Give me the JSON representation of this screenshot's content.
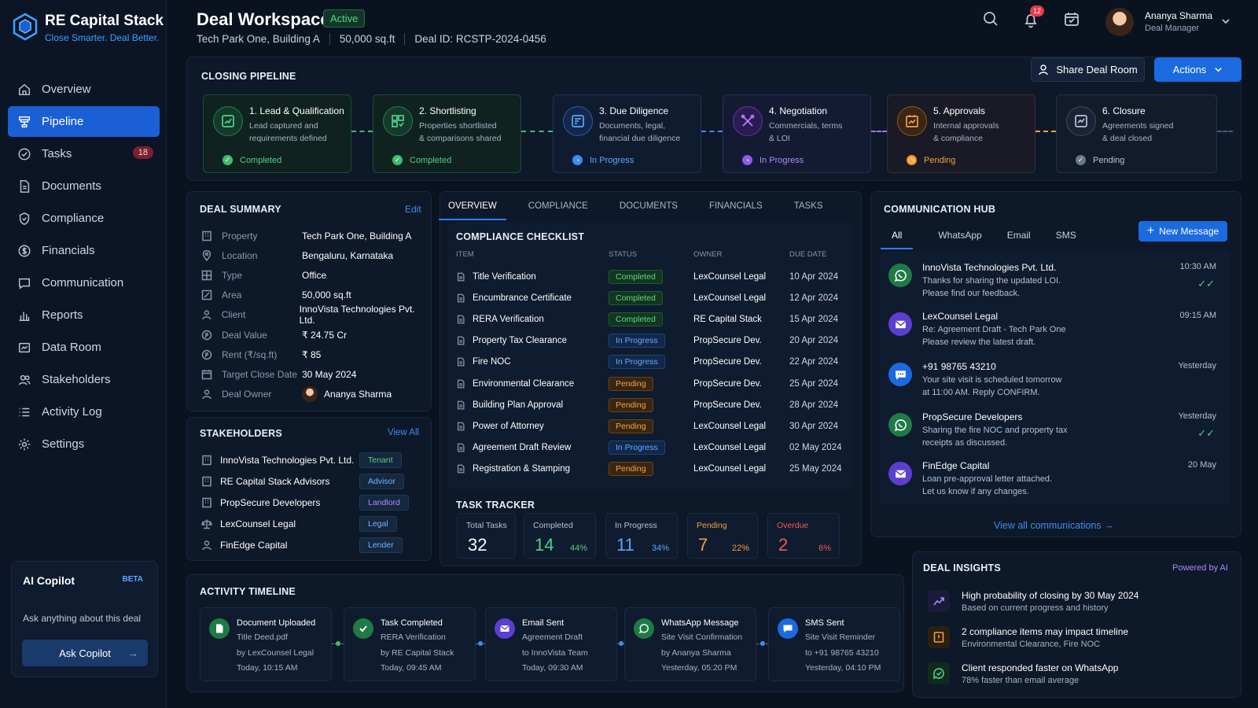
{
  "brand": {
    "name": "RE Capital Stack",
    "tagline": "Close Smarter. Deal Better."
  },
  "nav": [
    {
      "label": "Overview",
      "icon": "home-icon"
    },
    {
      "label": "Pipeline",
      "icon": "pipeline-icon",
      "active": true
    },
    {
      "label": "Tasks",
      "icon": "check-circle-icon",
      "badge": "18"
    },
    {
      "label": "Documents",
      "icon": "document-icon"
    },
    {
      "label": "Compliance",
      "icon": "shield-icon"
    },
    {
      "label": "Financials",
      "icon": "dollar-icon"
    },
    {
      "label": "Communication",
      "icon": "chat-icon"
    },
    {
      "label": "Reports",
      "icon": "bar-chart-icon"
    },
    {
      "label": "Data Room",
      "icon": "folder-icon"
    },
    {
      "label": "Stakeholders",
      "icon": "users-icon"
    },
    {
      "label": "Activity Log",
      "icon": "list-icon"
    },
    {
      "label": "Settings",
      "icon": "gear-icon"
    }
  ],
  "copilot": {
    "title": "AI  Copilot",
    "beta": "BETA",
    "prompt": "Ask anything about this deal",
    "button": "Ask Copilot"
  },
  "header": {
    "title": "Deal Workspace",
    "status": "Active",
    "property": "Tech Park One, Building A",
    "area": "50,000 sq.ft",
    "deal_id": "Deal ID: RCSTP-2024-0456",
    "notifications": "12",
    "user_name": "Ananya Sharma",
    "user_role": "Deal Manager",
    "share_label": "Share Deal Room",
    "actions_label": "Actions"
  },
  "pipeline": {
    "title": "CLOSING PIPELINE",
    "stages": [
      {
        "title": "1. Lead & Qualification",
        "desc1": "Lead captured and",
        "desc2": "requirements defined",
        "status": "Completed",
        "color": "#3dbd6e"
      },
      {
        "title": "2. Shortlisting",
        "desc1": "Properties shortlisted",
        "desc2": "& comparisons shared",
        "status": "Completed",
        "color": "#3dbd6e"
      },
      {
        "title": "3. Due Diligence",
        "desc1": "Documents, legal,",
        "desc2": "financial due diligence",
        "status": "In Progress",
        "color": "#3b8cf5"
      },
      {
        "title": "4. Negotiation",
        "desc1": "Commercials, terms",
        "desc2": "& LOI",
        "status": "In Progress",
        "color": "#8a5cf0"
      },
      {
        "title": "5. Approvals",
        "desc1": "Internal approvals",
        "desc2": "& compliance",
        "status": "Pending",
        "color": "#f0962e"
      },
      {
        "title": "6. Closure",
        "desc1": "Agreements signed",
        "desc2": "& deal closed",
        "status": "Pending",
        "color": "#9aa6b8"
      }
    ]
  },
  "deal_summary": {
    "title": "DEAL SUMMARY",
    "edit": "Edit",
    "rows": [
      {
        "label": "Property",
        "value": "Tech Park One, Building A"
      },
      {
        "label": "Location",
        "value": "Bengaluru, Karnataka"
      },
      {
        "label": "Type",
        "value": "Office"
      },
      {
        "label": "Area",
        "value": "50,000 sq.ft"
      },
      {
        "label": "Client",
        "value": "InnoVista Technologies Pvt. Ltd."
      },
      {
        "label": "Deal Value",
        "value": "₹ 24.75 Cr"
      },
      {
        "label": "Rent (₹/sq.ft)",
        "value": "₹ 85"
      },
      {
        "label": "Target Close Date",
        "value": "30 May 2024"
      },
      {
        "label": "Deal Owner",
        "value": "Ananya Sharma"
      }
    ]
  },
  "stakeholders": {
    "title": "STAKEHOLDERS",
    "view_all": "View All",
    "items": [
      {
        "name": "InnoVista Technologies Pvt. Ltd.",
        "role": "Tenant",
        "color": "#4fd08a"
      },
      {
        "name": "RE Capital Stack Advisors",
        "role": "Advisor",
        "color": "#6fb2ff"
      },
      {
        "name": "PropSecure Developers",
        "role": "Landlord",
        "color": "#a98bff"
      },
      {
        "name": "LexCounsel Legal",
        "role": "Legal",
        "color": "#6fb2ff"
      },
      {
        "name": "FinEdge Capital",
        "role": "Lender",
        "color": "#6fb2ff"
      }
    ]
  },
  "tabs": [
    "OVERVIEW",
    "COMPLIANCE",
    "DOCUMENTS",
    "FINANCIALS",
    "TASKS"
  ],
  "checklist": {
    "title": "COMPLIANCE CHECKLIST",
    "headers": [
      "ITEM",
      "STATUS",
      "OWNER",
      "DUE DATE"
    ],
    "rows": [
      {
        "item": "Title Verification",
        "status": "Completed",
        "owner": "LexCounsel Legal",
        "due": "10 Apr 2024"
      },
      {
        "item": "Encumbrance Certificate",
        "status": "Completed",
        "owner": "LexCounsel Legal",
        "due": "12 Apr 2024"
      },
      {
        "item": "RERA Verification",
        "status": "Completed",
        "owner": "RE Capital Stack",
        "due": "15 Apr 2024"
      },
      {
        "item": "Property Tax Clearance",
        "status": "In Progress",
        "owner": "PropSecure Dev.",
        "due": "20 Apr 2024"
      },
      {
        "item": "Fire NOC",
        "status": "In Progress",
        "owner": "PropSecure Dev.",
        "due": "22 Apr 2024"
      },
      {
        "item": "Environmental Clearance",
        "status": "Pending",
        "owner": "PropSecure Dev.",
        "due": "25 Apr 2024"
      },
      {
        "item": "Building Plan Approval",
        "status": "Pending",
        "owner": "PropSecure Dev.",
        "due": "28 Apr 2024"
      },
      {
        "item": "Power of Attorney",
        "status": "Pending",
        "owner": "LexCounsel Legal",
        "due": "30 Apr 2024"
      },
      {
        "item": "Agreement Draft Review",
        "status": "In Progress",
        "owner": "LexCounsel Legal",
        "due": "02 May 2024"
      },
      {
        "item": "Registration & Stamping",
        "status": "Pending",
        "owner": "LexCounsel Legal",
        "due": "25 May 2024"
      }
    ]
  },
  "task_tracker": {
    "title": "TASK TRACKER",
    "stats": [
      {
        "label": "Total Tasks",
        "value": "32",
        "pct": "",
        "color": "#b8c3d3",
        "valcolor": "#ffffff"
      },
      {
        "label": "Completed",
        "value": "14",
        "pct": "44%",
        "color": "#b8c3d3",
        "valcolor": "#4fd08a"
      },
      {
        "label": "In Progress",
        "value": "11",
        "pct": "34%",
        "color": "#b8c3d3",
        "valcolor": "#5aa8ff"
      },
      {
        "label": "Pending",
        "value": "7",
        "pct": "22%",
        "color": "#f0a040",
        "valcolor": "#f0a040"
      },
      {
        "label": "Overdue",
        "value": "2",
        "pct": "6%",
        "color": "#ef5a5a",
        "valcolor": "#ef5a5a"
      }
    ]
  },
  "comm": {
    "title": "COMMUNICATION HUB",
    "channels": [
      "All",
      "WhatsApp",
      "Email",
      "SMS"
    ],
    "new_message": "New Message",
    "view_all": "View all communications →",
    "messages": [
      {
        "from": "InnoVista Technologies Pvt. Ltd.",
        "line1": "Thanks for sharing the updated LOI.",
        "line2": "Please find our feedback.",
        "time": "10:30 AM",
        "type": "whatsapp",
        "read": true
      },
      {
        "from": "LexCounsel Legal",
        "line1": "Re: Agreement Draft - Tech Park One",
        "line2": "Please review the latest draft.",
        "time": "09:15 AM",
        "type": "email",
        "read": false
      },
      {
        "from": "+91 98765 43210",
        "line1": "Your site visit is scheduled tomorrow",
        "line2": "at 11:00 AM. Reply CONFIRM.",
        "time": "Yesterday",
        "type": "sms",
        "read": false
      },
      {
        "from": "PropSecure Developers",
        "line1": "Sharing the fire NOC and property tax",
        "line2": "receipts as discussed.",
        "time": "Yesterday",
        "type": "whatsapp",
        "read": true
      },
      {
        "from": "FinEdge Capital",
        "line1": "Loan pre-approval letter attached.",
        "line2": "Let us know if any changes.",
        "time": "20 May",
        "type": "email",
        "read": false
      }
    ]
  },
  "timeline": {
    "title": "ACTIVITY TIMELINE",
    "events": [
      {
        "title": "Document Uploaded",
        "l1": "Title Deed.pdf",
        "l2": "by LexCounsel Legal",
        "l3": "Today, 10:15 AM",
        "type": "doc"
      },
      {
        "title": "Task Completed",
        "l1": "RERA Verification",
        "l2": "by RE Capital Stack",
        "l3": "Today, 09:45 AM",
        "type": "check"
      },
      {
        "title": "Email Sent",
        "l1": "Agreement Draft",
        "l2": "to InnoVista Team",
        "l3": "Today, 09:30 AM",
        "type": "email"
      },
      {
        "title": "WhatsApp Message",
        "l1": "Site Visit Confirmation",
        "l2": "by Ananya Sharma",
        "l3": "Yesterday, 05:20 PM",
        "type": "whatsapp"
      },
      {
        "title": "SMS Sent",
        "l1": "Site Visit Reminder",
        "l2": "to +91 98765 43210",
        "l3": "Yesterday, 04:10 PM",
        "type": "sms"
      }
    ]
  },
  "insights": {
    "title": "DEAL INSIGHTS",
    "powered": "Powered by AI",
    "items": [
      {
        "title": "High probability of closing by 30 May 2024",
        "sub": "Based on current progress and history"
      },
      {
        "title": "2 compliance items may impact timeline",
        "sub": "Environmental Clearance, Fire NOC"
      },
      {
        "title": "Client responded faster on WhatsApp",
        "sub": "78% faster than email average"
      }
    ]
  }
}
